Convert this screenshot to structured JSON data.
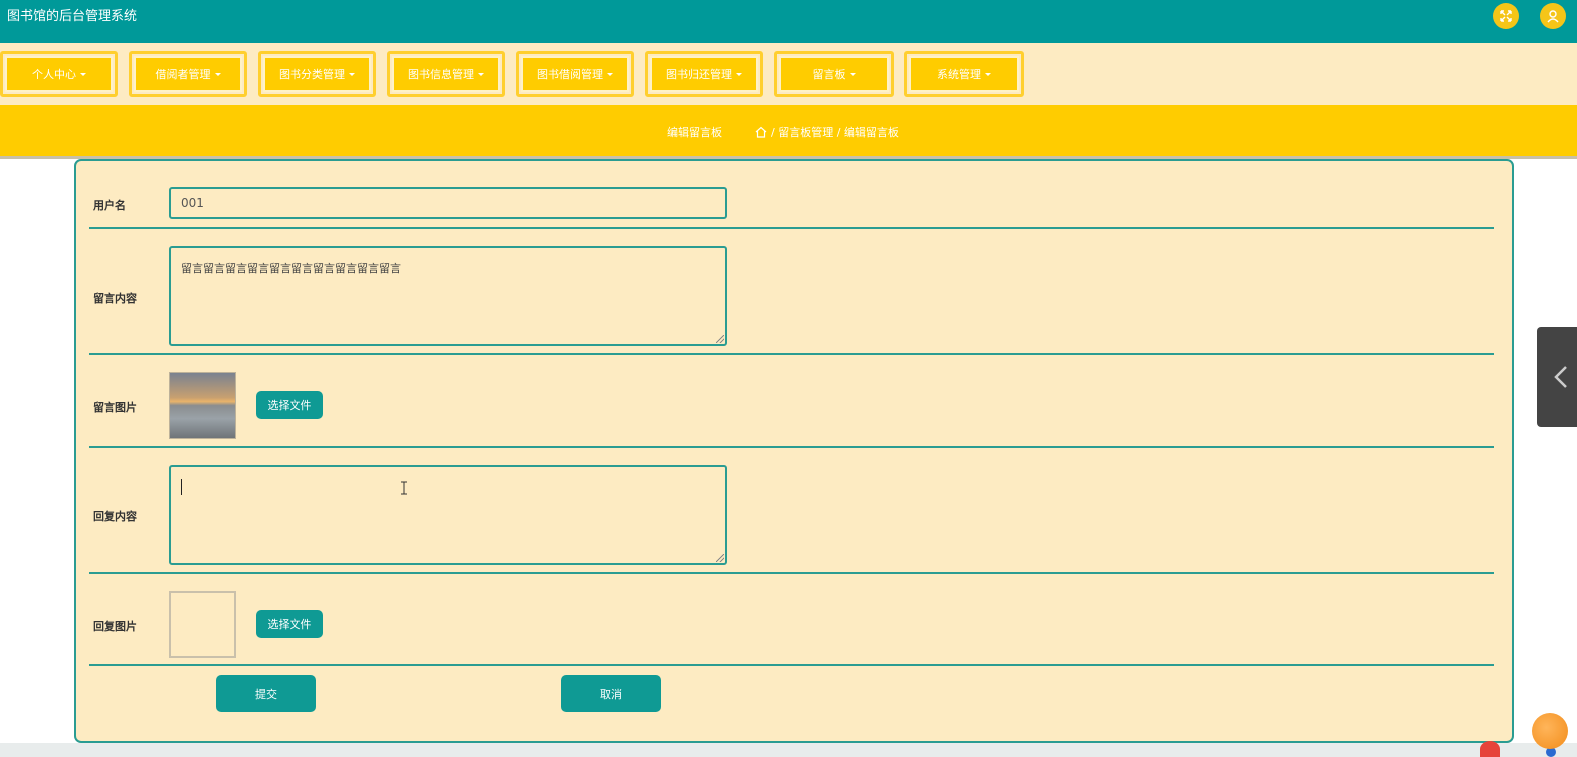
{
  "header": {
    "title": "图书馆的后台管理系统",
    "fullscreen_icon": "expand-arrows-icon",
    "user_icon": "user-icon",
    "accent_color": "#009999"
  },
  "menu": {
    "items": [
      {
        "label": "个人中心"
      },
      {
        "label": "借阅者管理"
      },
      {
        "label": "图书分类管理"
      },
      {
        "label": "图书信息管理"
      },
      {
        "label": "图书借阅管理"
      },
      {
        "label": "图书归还管理"
      },
      {
        "label": "留言板"
      },
      {
        "label": "系统管理"
      }
    ],
    "color": "#ffcc00"
  },
  "breadcrumb": {
    "page_title": "编辑留言板",
    "path": "/ 留言板管理 / 编辑留言板"
  },
  "form": {
    "username": {
      "label": "用户名",
      "value": "001"
    },
    "content": {
      "label": "留言内容",
      "value": "留言留言留言留言留言留言留言留言留言留言"
    },
    "image": {
      "label": "留言图片",
      "button": "选择文件"
    },
    "reply": {
      "label": "回复内容",
      "value": ""
    },
    "reply_image": {
      "label": "回复图片",
      "button": "选择文件"
    },
    "submit": "提交",
    "cancel": "取消"
  }
}
